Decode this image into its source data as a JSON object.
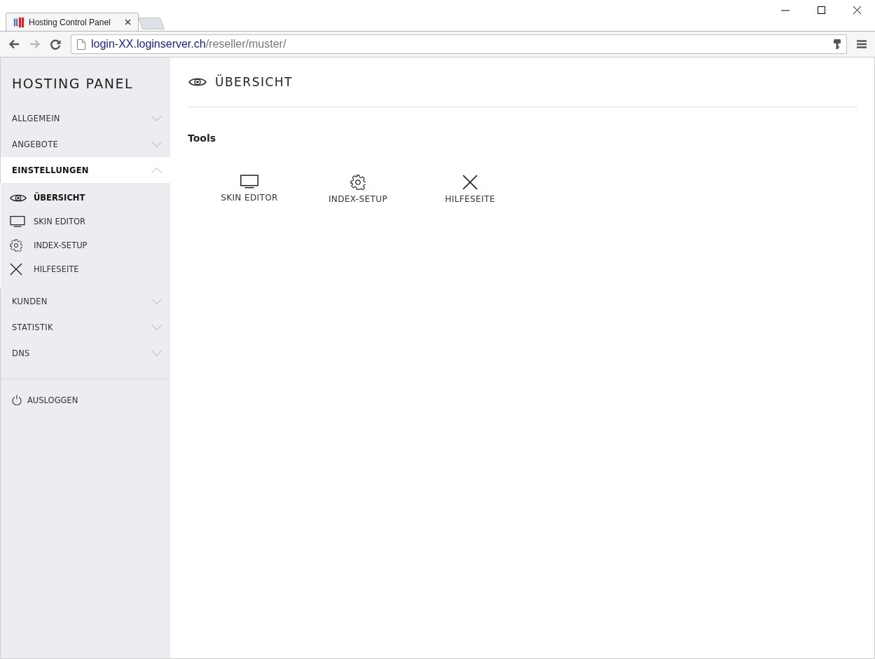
{
  "browser": {
    "tab_title": "Hosting Control Panel",
    "url_host": "login-XX.loginserver.ch",
    "url_path": "/reseller/muster/"
  },
  "sidebar": {
    "title": "HOSTING PANEL",
    "sections": [
      {
        "label": "ALLGEMEIN",
        "expanded": false
      },
      {
        "label": "ANGEBOTE",
        "expanded": false
      },
      {
        "label": "EINSTELLUNGEN",
        "expanded": true,
        "children": [
          {
            "label": "ÜBERSICHT",
            "kind": "eye",
            "selected": true
          },
          {
            "label": "SKIN EDITOR",
            "kind": "monitor",
            "selected": false
          },
          {
            "label": "INDEX-SETUP",
            "kind": "gear",
            "selected": false
          },
          {
            "label": "HILFESEITE",
            "kind": "cross",
            "selected": false
          }
        ]
      },
      {
        "label": "KUNDEN",
        "expanded": false
      },
      {
        "label": "STATISTIK",
        "expanded": false
      },
      {
        "label": "DNS",
        "expanded": false
      }
    ],
    "logout": "AUSLOGGEN"
  },
  "main": {
    "title": "ÜBERSICHT",
    "heading": "Tools",
    "tools": [
      {
        "label": "SKIN EDITOR",
        "kind": "monitor"
      },
      {
        "label": "INDEX-SETUP",
        "kind": "gear"
      },
      {
        "label": "HILFESEITE",
        "kind": "cross"
      }
    ]
  }
}
